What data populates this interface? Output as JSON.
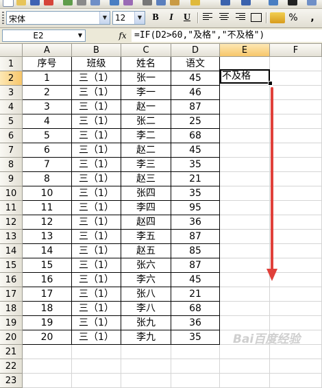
{
  "toolbar": {
    "font_name": "宋体",
    "font_size": "12",
    "bold_label": "B",
    "italic_label": "I",
    "underline_label": "U",
    "percent_label": "%",
    "comma_label": ","
  },
  "formula_bar": {
    "name_box": "E2",
    "fx_label": "fx",
    "formula": "=IF(D2>60,\"及格\",\"不及格\")"
  },
  "grid": {
    "columns": [
      "A",
      "B",
      "C",
      "D",
      "E",
      "F"
    ],
    "selected_column": "E",
    "selected_row": 2,
    "active_cell_value": "不及格",
    "header_row": [
      "序号",
      "班级",
      "姓名",
      "语文"
    ],
    "rows": [
      [
        "1",
        "三（1）",
        "张一",
        "45"
      ],
      [
        "2",
        "三（1）",
        "李一",
        "46"
      ],
      [
        "3",
        "三（1）",
        "赵一",
        "87"
      ],
      [
        "4",
        "三（1）",
        "张二",
        "25"
      ],
      [
        "5",
        "三（1）",
        "李二",
        "68"
      ],
      [
        "6",
        "三（1）",
        "赵二",
        "45"
      ],
      [
        "7",
        "三（1）",
        "李三",
        "35"
      ],
      [
        "8",
        "三（1）",
        "赵三",
        "21"
      ],
      [
        "10",
        "三（1）",
        "张四",
        "35"
      ],
      [
        "11",
        "三（1）",
        "李四",
        "95"
      ],
      [
        "12",
        "三（1）",
        "赵四",
        "36"
      ],
      [
        "13",
        "三（1）",
        "李五",
        "87"
      ],
      [
        "14",
        "三（1）",
        "赵五",
        "85"
      ],
      [
        "15",
        "三（1）",
        "张六",
        "87"
      ],
      [
        "16",
        "三（1）",
        "李六",
        "45"
      ],
      [
        "17",
        "三（1）",
        "张八",
        "21"
      ],
      [
        "18",
        "三（1）",
        "李八",
        "68"
      ],
      [
        "19",
        "三（1）",
        "张九",
        "36"
      ],
      [
        "20",
        "三（1）",
        "李九",
        "35"
      ]
    ],
    "row_numbers": [
      "1",
      "2",
      "3",
      "4",
      "5",
      "6",
      "7",
      "8",
      "9",
      "10",
      "11",
      "12",
      "13",
      "14",
      "15",
      "16",
      "17",
      "18",
      "19",
      "20",
      "21",
      "22",
      "23"
    ]
  },
  "colors": {
    "arrow": "#e0403a",
    "selected_header": "#f7c66a"
  },
  "watermark": "Bai百度经验"
}
